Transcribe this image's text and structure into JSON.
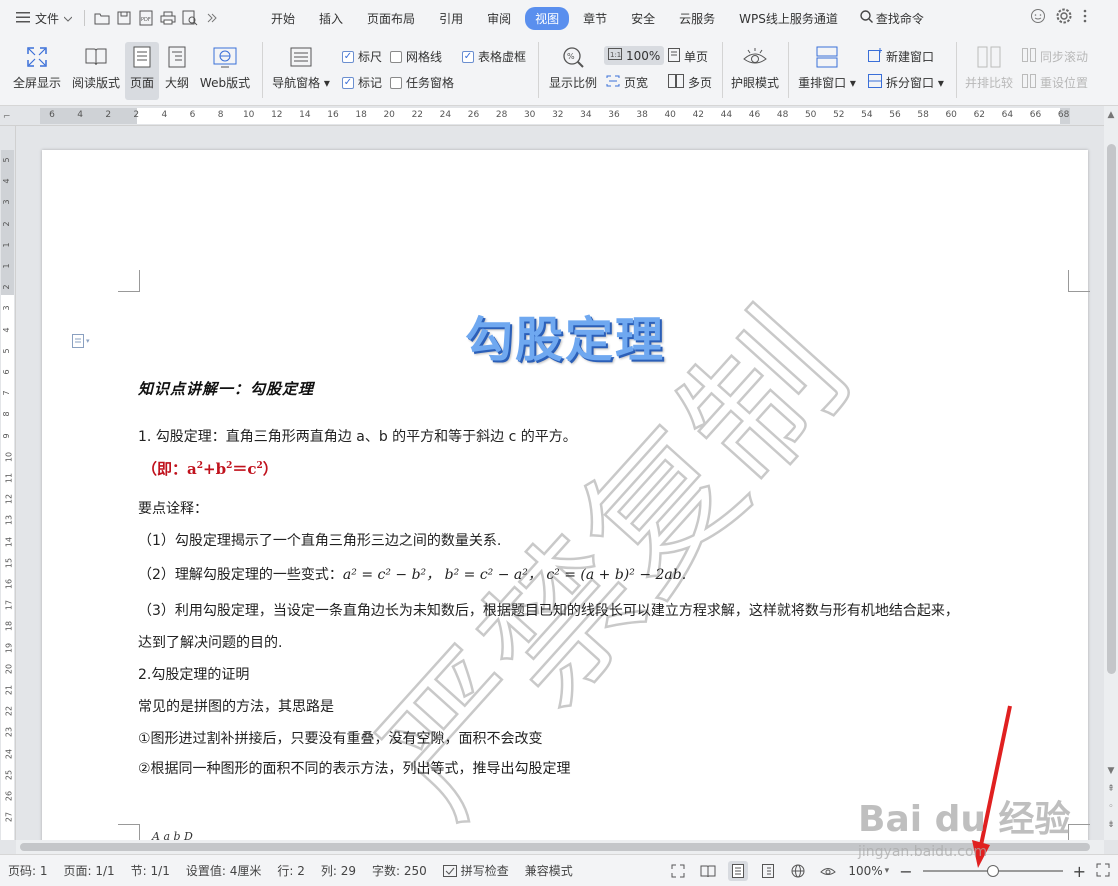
{
  "menubar": {
    "file_label": "文件",
    "tabs": [
      "开始",
      "插入",
      "页面布局",
      "引用",
      "审阅",
      "视图",
      "章节",
      "安全",
      "云服务",
      "WPS线上服务通道"
    ],
    "active_tab": "视图",
    "find_label": "查找命令"
  },
  "ribbon": {
    "fullscreen": "全屏显示",
    "reading": "阅读版式",
    "page": "页面",
    "outline": "大纲",
    "web": "Web版式",
    "nav_pane": "导航窗格",
    "ruler": "标尺",
    "gridlines": "网格线",
    "table_gridlines": "表格虚框",
    "marks": "标记",
    "task_pane": "任务窗格",
    "zoom": "显示比例",
    "zoom_100": "100%",
    "page_width": "页宽",
    "one_page": "单页",
    "multi_page": "多页",
    "eye_mode": "护眼模式",
    "arrange": "重排窗口",
    "new_window": "新建窗口",
    "split_window": "拆分窗口",
    "side_by_side": "并排比较",
    "sync_scroll": "同步滚动",
    "reset_position": "重设位置"
  },
  "ruler": {
    "h_numbers": [
      "6",
      "4",
      "2",
      "2",
      "4",
      "6",
      "8",
      "10",
      "12",
      "14",
      "16",
      "18",
      "20",
      "22",
      "24",
      "26",
      "28",
      "30",
      "32",
      "34",
      "36",
      "38",
      "40",
      "42",
      "44",
      "46",
      "48",
      "50",
      "52",
      "54",
      "56",
      "58",
      "60",
      "62",
      "64",
      "66",
      "68"
    ],
    "v_numbers": [
      "5",
      "4",
      "3",
      "2",
      "1",
      "1",
      "2",
      "3",
      "4",
      "5",
      "6",
      "7",
      "8",
      "9",
      "10",
      "11",
      "12",
      "13",
      "14",
      "15",
      "16",
      "17",
      "18",
      "19",
      "20",
      "21",
      "22",
      "23",
      "24",
      "25",
      "26",
      "27"
    ]
  },
  "document": {
    "title": "勾股定理",
    "heading": "知识点讲解一：勾股定理",
    "p1": "1. 勾股定理：直角三角形两直角边 a、b 的平方和等于斜边 c 的平方。",
    "formula_prefix": "（即：a",
    "formula_mid1": "+b",
    "formula_mid2": "＝c",
    "formula_suffix": "）",
    "points_title": "要点诠释：",
    "point1": "（1）勾股定理揭示了一个直角三角形三边之间的数量关系.",
    "point2_prefix": "（2）理解勾股定理的一些变式：",
    "point2_math": "a² = c² − b²，  b² = c² − a²，   c² = (a + b)² − 2ab.",
    "point3_line1": "（3）利用勾股定理，当设定一条直角边长为未知数后，根据题目已知的线段长可以建立方程求解，这样就将数与形有机地结合起来，",
    "point3_line2": "达到了解决问题的目的.",
    "proof_title": "2.勾股定理的证明",
    "proof_intro": "常见的是拼图的方法，其思路是",
    "proof_1": "①图形进过割补拼接后，只要没有重叠，没有空隙，面积不会改变",
    "proof_2": "②根据同一种图形的面积不同的表示方法，列出等式，推导出勾股定理",
    "diagram_text": "A   a     b   D",
    "watermark": "严禁复制"
  },
  "statusbar": {
    "page_num": "页码: 1",
    "pages": "页面: 1/1",
    "section": "节: 1/1",
    "setting": "设置值: 4厘米",
    "row": "行: 2",
    "col": "列: 29",
    "words": "字数: 250",
    "spell": "拼写检查",
    "compat": "兼容模式",
    "zoom_label": "100%",
    "zoom_value": 0.5
  },
  "overlay": {
    "baidu_brand": "Bai du 经验",
    "baidu_url": "jingyan.baidu.com"
  },
  "colors": {
    "accent": "#5a8fee",
    "title_blue": "#6fa8f0",
    "formula_red": "#c0121d",
    "annotation_arrow": "#e02020"
  }
}
